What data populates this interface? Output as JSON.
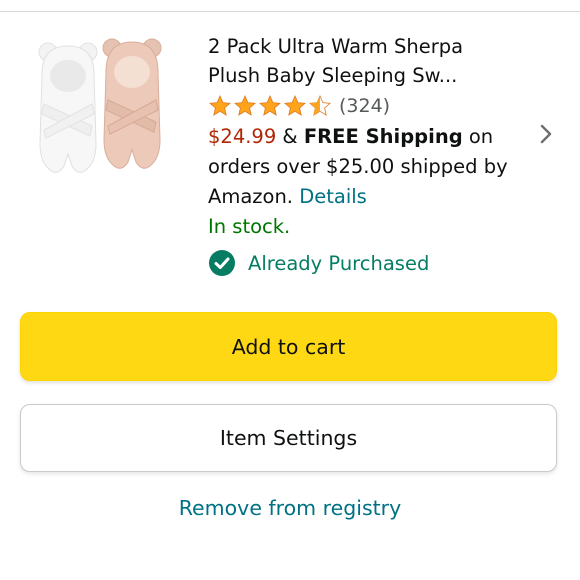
{
  "product": {
    "title": "2 Pack Ultra Warm Sherpa Plush Baby Sleeping Sw...",
    "rating": 4.5,
    "review_count": "(324)",
    "price": "$24.99",
    "shipping_prefix": " & ",
    "shipping_bold": "FREE Shipping",
    "shipping_rest": " on orders over $25.00 shipped by Amazon. ",
    "details_link": "Details",
    "stock": "In stock.",
    "purchased_label": "Already Purchased",
    "image_icon": "baby-sleeping-swaddle-image"
  },
  "buttons": {
    "add_to_cart": "Add to cart",
    "item_settings": "Item Settings"
  },
  "links": {
    "remove": "Remove from registry"
  },
  "colors": {
    "star": "#ffa41c",
    "price": "#b12704",
    "link": "#007185",
    "in_stock": "#007600",
    "cart_button": "#ffd814"
  }
}
